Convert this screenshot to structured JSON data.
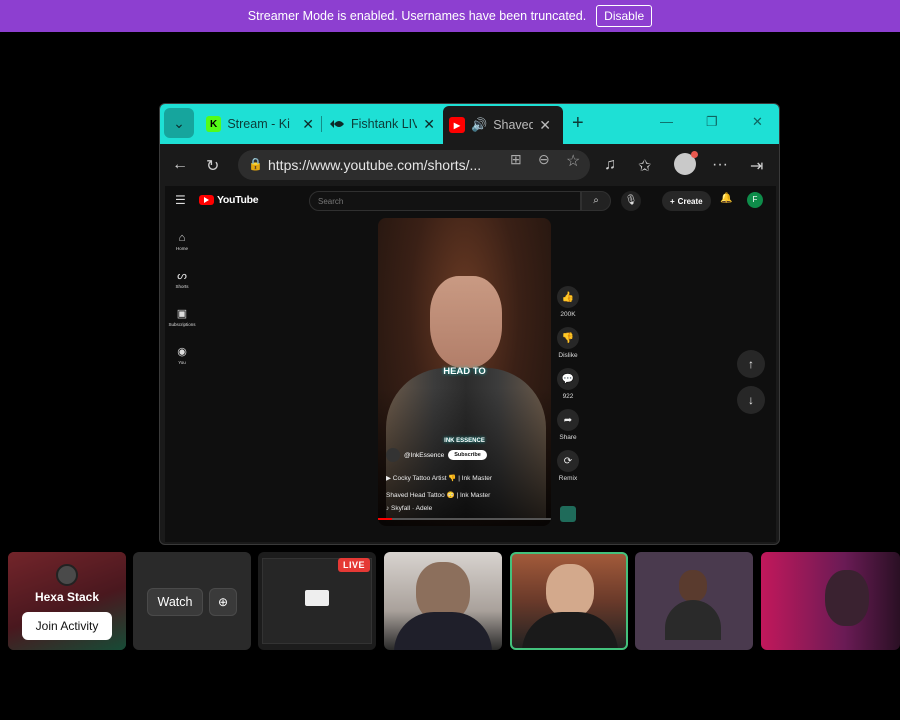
{
  "banner": {
    "message": "Streamer Mode is enabled. Usernames have been truncated.",
    "button": "Disable"
  },
  "browser": {
    "tabs": [
      {
        "title": "Stream - Ki",
        "favicon": "K"
      },
      {
        "title": "Fishtank LIV",
        "favicon": "fish"
      },
      {
        "title": "Shaved",
        "favicon": "youtube"
      }
    ],
    "url": "https://www.youtube.com/shorts/..."
  },
  "youtube": {
    "logo": "YouTube",
    "search_placeholder": "Search",
    "create_label": "Create",
    "user_initial": "F",
    "sidebar": [
      {
        "label": "Home",
        "icon": "home-icon"
      },
      {
        "label": "Shorts",
        "icon": "shorts-icon"
      },
      {
        "label": "Subscriptions",
        "icon": "subscriptions-icon"
      },
      {
        "label": "You",
        "icon": "you-icon"
      }
    ],
    "video": {
      "caption": "HEAD TO",
      "brand": "INK ESSENCE",
      "channel": "@InkEssence",
      "subscribe": "Subscribe",
      "line1": "▶ Cocky Tattoo Artist 👎 | Ink Master",
      "title": "Shaved Head Tattoo 😳 | Ink Master",
      "music": "♪ Skyfall · Adele"
    },
    "actions": {
      "like_count": "200K",
      "dislike": "Dislike",
      "comments": "922",
      "share": "Share",
      "remix": "Remix"
    }
  },
  "activities": {
    "user_name": "Hexa Stack",
    "join": "Join Activity",
    "watch": "Watch",
    "live": "LIVE"
  }
}
